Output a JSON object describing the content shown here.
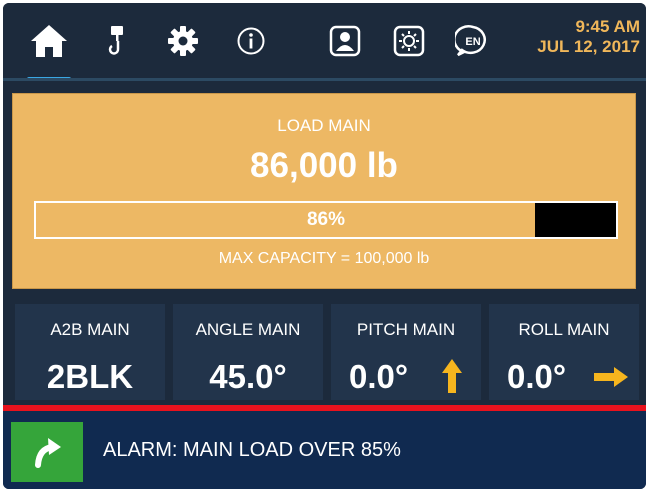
{
  "clock": {
    "time": "9:45 AM",
    "date": "JUL 12, 2017"
  },
  "nav": {
    "items": [
      {
        "name": "home",
        "icon": "home-icon"
      },
      {
        "name": "hook",
        "icon": "crane-hook-icon"
      },
      {
        "name": "settings",
        "icon": "gear-icon"
      },
      {
        "name": "info",
        "icon": "info-icon"
      },
      {
        "name": "user",
        "icon": "user-profile-icon"
      },
      {
        "name": "brightness",
        "icon": "brightness-icon"
      },
      {
        "name": "language",
        "icon": "language-icon",
        "label": "EN"
      }
    ],
    "active": "home"
  },
  "load": {
    "title": "LOAD MAIN",
    "value": "86,000 lb",
    "percent_label": "86%",
    "percent": 86,
    "max_capacity": "MAX CAPACITY = 100,000 lb"
  },
  "tiles": [
    {
      "label": "A2B MAIN",
      "value": "2BLK"
    },
    {
      "label": "ANGLE MAIN",
      "value": "45.0°"
    },
    {
      "label": "PITCH MAIN",
      "value": "0.0°",
      "arrow": "arrow-up-icon"
    },
    {
      "label": "ROLL MAIN",
      "value": "0.0°",
      "arrow": "arrow-right-icon"
    }
  ],
  "alarm": {
    "icon": "turn-left-arrow-icon",
    "text": "ALARM: MAIN LOAD OVER 85%"
  },
  "colors": {
    "accent": "#3aa7e3",
    "warning_panel": "#edb864",
    "arrow": "#f6b51e",
    "alarm_red": "#e8121d",
    "alarm_icon_green": "#35a53a",
    "clock": "#f0b75a"
  }
}
